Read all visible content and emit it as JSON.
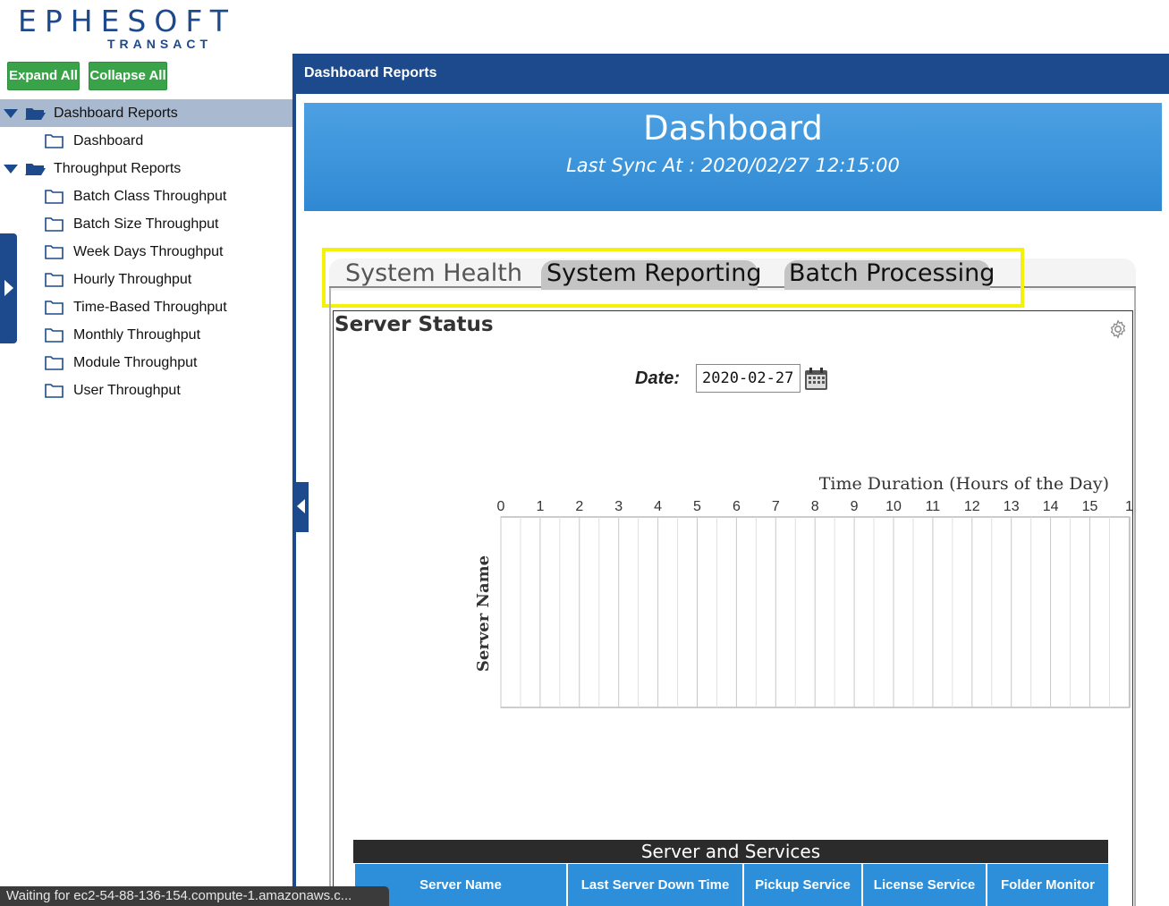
{
  "logo": {
    "main": "EPHESOFT",
    "sub": "TRANSACT"
  },
  "sidebar": {
    "expand_label": "Expand All",
    "collapse_label": "Collapse All",
    "groups": [
      {
        "label": "Dashboard Reports",
        "selected": true,
        "items": [
          "Dashboard"
        ]
      },
      {
        "label": "Throughput Reports",
        "selected": false,
        "items": [
          "Batch Class Throughput",
          "Batch Size Throughput",
          "Week Days Throughput",
          "Hourly Throughput",
          "Time-Based Throughput",
          "Monthly Throughput",
          "Module Throughput",
          "User Throughput"
        ]
      }
    ]
  },
  "status_bar": "Waiting for ec2-54-88-136-154.compute-1.amazonaws.c...",
  "main": {
    "header": "Dashboard Reports",
    "banner_title": "Dashboard",
    "banner_sync": "Last Sync At :  2020/02/27 12:15:00",
    "tabs": [
      "System Health",
      "System Reporting",
      "Batch Processing"
    ],
    "panel_title": "Server Status",
    "date_label": "Date:",
    "date_value": "2020-02-27"
  },
  "chart_data": {
    "type": "bar",
    "title": "Time Duration (Hours of the Day)",
    "xlabel": "Time Duration (Hours of the Day)",
    "ylabel": "Server Name",
    "x_ticks": [
      "0",
      "1",
      "2",
      "3",
      "4",
      "5",
      "6",
      "7",
      "8",
      "9",
      "10",
      "11",
      "12",
      "13",
      "14",
      "15",
      "1"
    ],
    "categories": [],
    "values": []
  },
  "services_table": {
    "title": "Server and Services",
    "columns": [
      "Server Name",
      "Last Server Down Time",
      "Pickup Service",
      "License Service",
      "Folder Monitor"
    ]
  },
  "colors": {
    "brand_blue": "#1d4a8c",
    "accent_green": "#3aa34a",
    "banner_blue": "#3891d8",
    "highlight": "#f4f20c"
  }
}
